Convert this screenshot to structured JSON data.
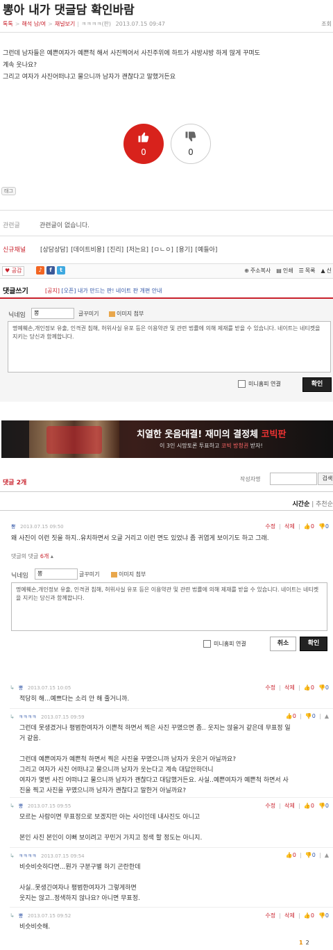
{
  "post": {
    "title": "뽕아 내가 댓글담 확인바람",
    "breadcrumb": [
      "톡톡",
      "해석 남/여",
      "채널보기"
    ],
    "author": "ㅋㅋㅋㅋ",
    "author_tag": "(판)",
    "date": "2013.07.15 09:47",
    "views_label": "조회",
    "body": [
      "그런데 남자들은 예쁜여자가 예쁜척 해서 사진찍어서 사진주위에 하트가 샤방샤방 하게 많게 꾸며도",
      "계속 웃나요?",
      "그리고 여자가 사진어떠냐고 물으니까 남자가 괜찮다고 말했거든요"
    ],
    "vote_up": "0",
    "vote_down": "0",
    "tag_label": "태그",
    "related_label": "관련글",
    "related_value": "관련글이 없습니다.",
    "new_channel_label": "신규채널",
    "channels": [
      "[상담상담]",
      "[데이트비용]",
      "[진리]",
      "[저는요]",
      "[ㅁㄴㅇ]",
      "[용기]",
      "[예들아]"
    ]
  },
  "toolbar": {
    "like_label": "공감",
    "sns": [
      {
        "name": "cyworld",
        "glyph": "♪",
        "color": "#f26522"
      },
      {
        "name": "facebook",
        "glyph": "f",
        "color": "#3b5998"
      },
      {
        "name": "twitter",
        "glyph": "t",
        "color": "#3fa9e0"
      }
    ],
    "tools": [
      "주소복사",
      "인쇄",
      "목록",
      "신"
    ]
  },
  "comment_write": {
    "title": "댓글쓰기",
    "notice_tag": "[공지]",
    "notice_text": "[오픈] 내가 만드는 판! 네이트 판 개편 안내",
    "nickname_label": "닉네임",
    "nickname_value": "뽕",
    "deco_label": "글꾸미기",
    "image_label": "이미지 첨부",
    "placeholder": "명예훼손,개인정보 유출, 인격권 침해, 허위사실 유포 등은 이용약관 및 관련 법률에 의해 제재를 받을 수 있습니다. 네이트는 네티켓을 지키는 당신과 함께합니다.",
    "minihompy_label": "미니홈피 연결",
    "confirm_label": "확인"
  },
  "banner": {
    "headline_a": "치열한 웃음대결!",
    "headline_b": "재미의 결정체",
    "headline_c": "코빅판",
    "sub_a": "이 3인 시망토론 투표하고",
    "sub_b": "코빅 방청권",
    "sub_c": "받자!"
  },
  "comments_section": {
    "count_label": "댓글",
    "count": "2개",
    "author_search_label": "작성자명",
    "search_label": "검색",
    "sort_time": "시간순",
    "sort_recommend": "추천순",
    "sort_sep": "|"
  },
  "comments": [
    {
      "user": "뽕",
      "date": "2013.07.15 09:50",
      "edit": "수정",
      "delete": "삭제",
      "up": "0",
      "down": "0",
      "text": [
        "왜 사진이 이런 짓을 하지..유치하면서 오글 거리고 이런 면도 있었냐 좀 귀엽게 보이기도 하고 그래."
      ]
    }
  ],
  "sub_comments": {
    "label": "댓글의 댓글",
    "count": "6개",
    "nickname_label": "닉네임",
    "nickname_value": "뽕",
    "deco_label": "글꾸미기",
    "image_label": "이미지 첨부",
    "placeholder": "명예훼손,개인정보 유출, 인격권 침해, 허위사실 유포 등은 이용약관 및 관련 법률에 의해 제재를 받을 수 있습니다. 네이트는 네티켓을 지키는 당신과 함께합니다.",
    "minihompy_label": "미니홈피 연결",
    "cancel_label": "취소",
    "confirm_label": "확인",
    "items": [
      {
        "user": "뽕",
        "date": "2013.07.15 10:05",
        "own": true,
        "edit": "수정",
        "delete": "삭제",
        "up": "0",
        "down": "0",
        "text": [
          "적당히 해...예쁘다는 소리 안 해 줄거니까."
        ]
      },
      {
        "user": "ㅋㅋㅋㅋ",
        "date": "2013.07.15 09:59",
        "own": false,
        "up": "0",
        "down": "0",
        "text": [
          "그런데 못생겼거나 평범한여자가 이쁜척 하면서 찍은 사진 꾸몄으면 좀.. 웃지는 않을거 같은데 무표정 일",
          "거 같음.",
          "",
          "그런데 예쁜여자가 예쁜척 하면서 찍은 사진을 꾸몄으니까 남자가 웃은거 아닐까요?",
          "그리고 여자가 사진 어떠냐고 물으니까 남자가 웃는다고 계속 대답안하더니",
          "여자가 몇번 사진 어떠냐고 물으니까 남자가 괜찮다고 대답했거든요. 사실..예쁜여자가 예쁜척 하면서 사",
          "진을 찍고 사진을 꾸몄으니까 남자가 괜찮다고 말한거 아닐까요?"
        ]
      },
      {
        "user": "뽕",
        "date": "2013.07.15 09:55",
        "own": true,
        "edit": "수정",
        "delete": "삭제",
        "up": "0",
        "down": "0",
        "text": [
          "모르는 사람이면 무표정으로 보겠지만 아는 사이인데 내사진도 아니고",
          "",
          "본인 사진 본인이 이뻐 보이려고 꾸민거 가지고 정색 할 정도는 아니지."
        ]
      },
      {
        "user": "ㅋㅋㅋㅋ",
        "date": "2013.07.15 09:54",
        "own": false,
        "up": "0",
        "down": "0",
        "text": [
          "비슷비슷하다면...뭔가 구분구별 하기 곤란한데",
          "",
          "사실..못생긴여자나 평범한여자가 그렇게하면",
          "웃지는 않고..정색하지 않나요? 아니면 무표정."
        ]
      },
      {
        "user": "뽕",
        "date": "2013.07.15 09:52",
        "own": true,
        "edit": "수정",
        "delete": "삭제",
        "up": "0",
        "down": "0",
        "text": [
          "비슷비슷해."
        ]
      }
    ]
  },
  "pagination": {
    "current": "1",
    "next": "2"
  }
}
